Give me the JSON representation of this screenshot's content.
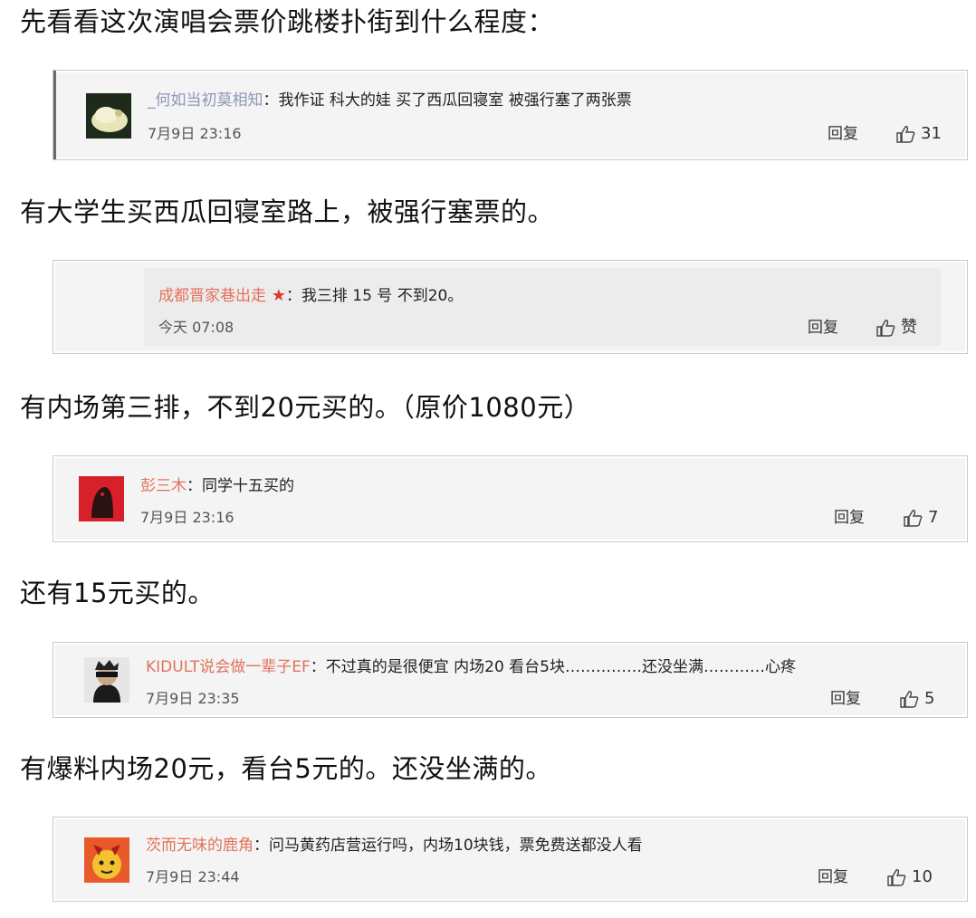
{
  "captions": [
    "先看看这次演唱会票价跳楼扑街到什么程度：",
    "有大学生买西瓜回寝室路上，被强行塞票的。",
    "有内场第三排，不到20元买的。（原价1080元）",
    "还有15元买的。",
    "有爆料内场20元，看台5元的。还没坐满的。"
  ],
  "comments": [
    {
      "username": "_何如当初莫相知",
      "separator": "：",
      "text": "我作证 科大的娃 买了西瓜回寝室 被强行塞了两张票",
      "time": "7月9日 23:16",
      "reply": "回复",
      "likes": "31"
    },
    {
      "username": "成都晋家巷出走",
      "separator": "：",
      "text": "我三排 15 号 不到20。",
      "time": "今天 07:08",
      "reply": "回复",
      "likes": "赞"
    },
    {
      "username": "彭三木",
      "separator": "：",
      "text": "同学十五买的",
      "time": "7月9日 23:16",
      "reply": "回复",
      "likes": "7"
    },
    {
      "username": "KIDULT说会做一辈子EF",
      "separator": "：",
      "text": "不过真的是很便宜 内场20 看台5块……………还没坐满…………心疼",
      "time": "7月9日 23:35",
      "reply": "回复",
      "likes": "5"
    },
    {
      "username": "茨而无味的鹿角",
      "separator": "：",
      "text": "问马黄药店营运行吗，内场10块钱，票免费送都没人看",
      "time": "7月9日 23:44",
      "reply": "回复",
      "likes": "10"
    }
  ],
  "colors": {
    "username": "#8e97b8",
    "username_alt": "#e2725b",
    "card_bg": "#f4f4f4",
    "card_border": "#c9c9c9"
  },
  "icons": {
    "like": "thumbs-up-icon",
    "badge": "star-icon"
  }
}
